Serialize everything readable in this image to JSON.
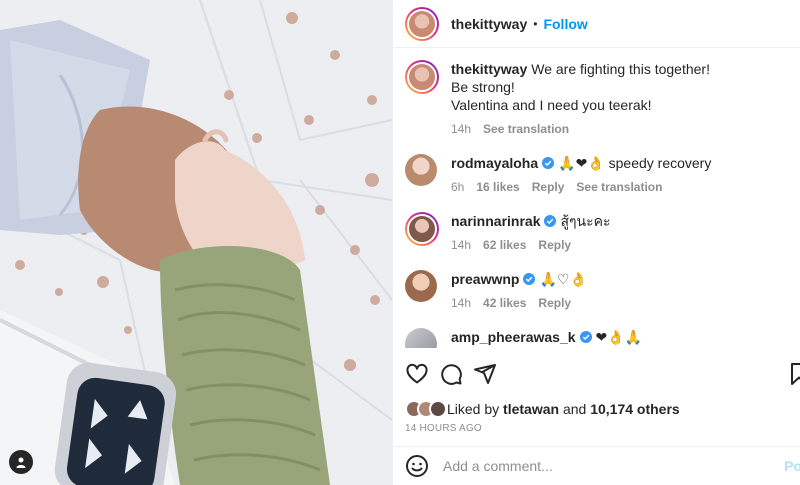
{
  "post": {
    "username": "thekittyway",
    "separator": "•",
    "follow_label": "Follow",
    "caption_lines": [
      "We are fighting this together!",
      "Be strong!",
      "Valentina and I need you teerak!"
    ],
    "caption_time": "14h",
    "see_translation": "See translation"
  },
  "comments": [
    {
      "user": "rodmayaloha",
      "verified": true,
      "text": "🙏❤👌 speedy recovery",
      "time": "6h",
      "likes": "16 likes",
      "reply": "Reply",
      "translation": "See translation",
      "avatar_color": "#b98a6e"
    },
    {
      "user": "narinnarinrak",
      "verified": true,
      "text": "สู้ๆนะคะ",
      "time": "14h",
      "likes": "62 likes",
      "reply": "Reply",
      "avatar_color": "#7d5a4a"
    },
    {
      "user": "preawwnp",
      "verified": true,
      "text": "🙏♡👌",
      "time": "14h",
      "likes": "42 likes",
      "reply": "Reply",
      "avatar_color": "#9b6a4e"
    },
    {
      "user": "amp_pheerawas_k",
      "verified": true,
      "text": "❤👌🙏",
      "avatar_color": "#a7a9ad"
    }
  ],
  "likes": {
    "prefix": "Liked by",
    "user": "tletawan",
    "joiner": "and",
    "count": "10,174 others"
  },
  "timestamp": "14 HOURS AGO",
  "add_comment": {
    "placeholder": "Add a comment...",
    "post_label": "Po"
  },
  "icons": [
    "heart-icon",
    "comment-icon",
    "share-icon",
    "bookmark-icon",
    "smiley-icon",
    "verified-icon",
    "user-tag-icon"
  ],
  "colors": {
    "accent": "#0095f6",
    "verified": "#3897f0",
    "heart_red": "#e0245e",
    "sleeve": "#98a47a",
    "blanket": "#eef0f4"
  }
}
